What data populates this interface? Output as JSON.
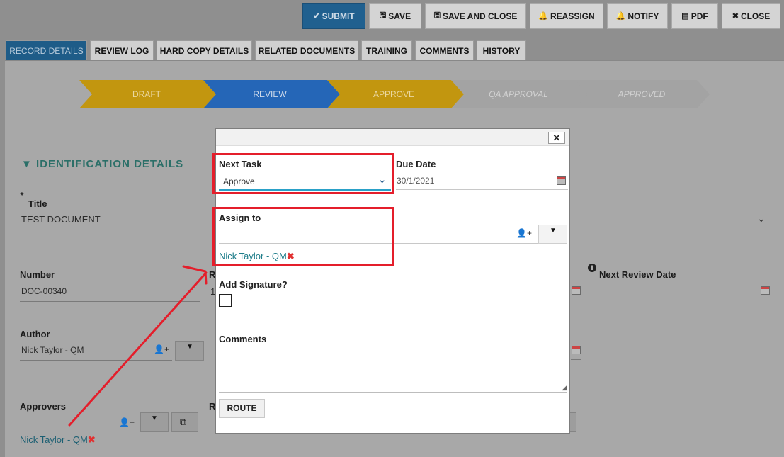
{
  "toolbar": {
    "submit": "SUBMIT",
    "save": "SAVE",
    "save_close": "SAVE AND CLOSE",
    "reassign": "REASSIGN",
    "notify": "NOTIFY",
    "pdf": "PDF",
    "close": "CLOSE",
    "icons": [
      "check-icon",
      "save-icon",
      "save-icon",
      "bell-icon",
      "bell-icon",
      "pdf-icon",
      "close-icon"
    ]
  },
  "tabs": [
    "RECORD DETAILS",
    "REVIEW LOG",
    "HARD COPY DETAILS",
    "RELATED DOCUMENTS",
    "TRAINING",
    "COMMENTS",
    "HISTORY"
  ],
  "workflow": [
    "DRAFT",
    "REVIEW",
    "APPROVE",
    "QA APPROVAL",
    "APPROVED"
  ],
  "section": {
    "title": "IDENTIFICATION DETAILS",
    "toggle": "▼"
  },
  "form": {
    "required_mark": "*",
    "title_label": "Title",
    "title_value": "TEST DOCUMENT",
    "number_label": "Number",
    "number_value": "DOC-00340",
    "partial_r1": "R",
    "partial_1": "1",
    "next_review_label": "Next Review Date",
    "author_label": "Author",
    "author_value": "Nick Taylor - QM",
    "approvers_label": "Approvers",
    "approvers_value": "Nick Taylor - QM",
    "partial_r2": "R"
  },
  "modal": {
    "next_task_label": "Next Task",
    "next_task_value": "Approve",
    "due_date_label": "Due Date",
    "due_date_value": "30/1/2021",
    "assign_label": "Assign to",
    "assignee": "Nick Taylor - QM",
    "signature_label": "Add Signature?",
    "comments_label": "Comments",
    "route_button": "ROUTE",
    "close_glyph": "✕"
  },
  "colors": {
    "draft": "#c2960f",
    "review": "#2566b7",
    "approve": "#c2960f",
    "qa_approval": "#a3a3a3",
    "approved": "#a3a3a3",
    "annotation": "#e41e2b",
    "section_title": "#2b6f68"
  }
}
